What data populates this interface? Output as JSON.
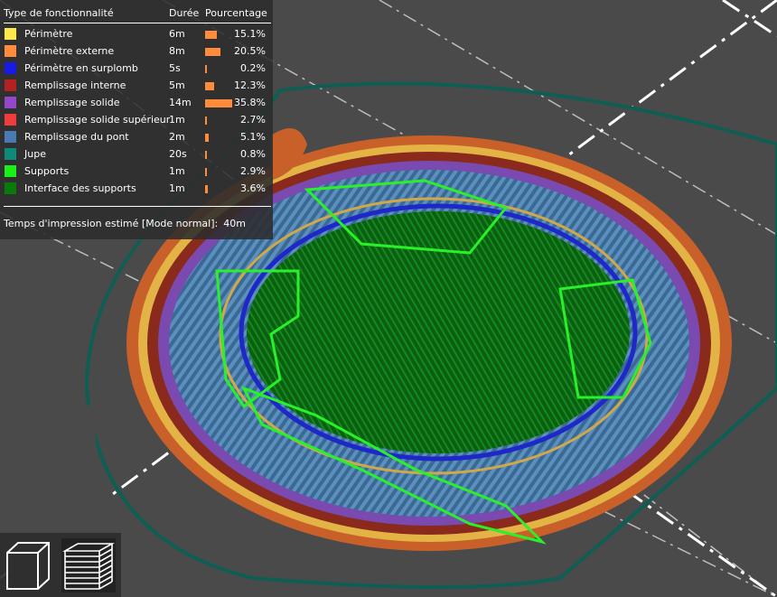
{
  "legend": {
    "headers": {
      "type": "Type de fonctionnalité",
      "duration": "Durée",
      "percentage": "Pourcentage"
    },
    "rows": [
      {
        "name": "Périmètre",
        "duration": "6m",
        "percent": "15.1%",
        "value": 15.1,
        "color": "#ffe84a"
      },
      {
        "name": "Périmètre externe",
        "duration": "8m",
        "percent": "20.5%",
        "value": 20.5,
        "color": "#ff8c3c"
      },
      {
        "name": "Périmètre en surplomb",
        "duration": "5s",
        "percent": "0.2%",
        "value": 0.2,
        "color": "#1a1ae6"
      },
      {
        "name": "Remplissage interne",
        "duration": "5m",
        "percent": "12.3%",
        "value": 12.3,
        "color": "#b22222"
      },
      {
        "name": "Remplissage solide",
        "duration": "14m",
        "percent": "35.8%",
        "value": 35.8,
        "color": "#9447c8"
      },
      {
        "name": "Remplissage solide supérieur",
        "duration": "1m",
        "percent": "2.7%",
        "value": 2.7,
        "color": "#f03c3c"
      },
      {
        "name": "Remplissage du pont",
        "duration": "2m",
        "percent": "5.1%",
        "value": 5.1,
        "color": "#4a7ab4"
      },
      {
        "name": "Jupe",
        "duration": "20s",
        "percent": "0.8%",
        "value": 0.8,
        "color": "#0e8a78"
      },
      {
        "name": "Supports",
        "duration": "1m",
        "percent": "2.9%",
        "value": 2.9,
        "color": "#18f018"
      },
      {
        "name": "Interface des supports",
        "duration": "1m",
        "percent": "3.6%",
        "value": 3.6,
        "color": "#0a7a0a"
      }
    ],
    "estimated_time_label": "Temps d'impression estimé [Mode normal]:",
    "estimated_time_value": "40m"
  },
  "toolbar": {
    "buttons": [
      {
        "name": "view-3d-button",
        "icon": "cube-icon",
        "active": false
      },
      {
        "name": "view-layers-button",
        "icon": "layers-icon",
        "active": true
      }
    ]
  }
}
